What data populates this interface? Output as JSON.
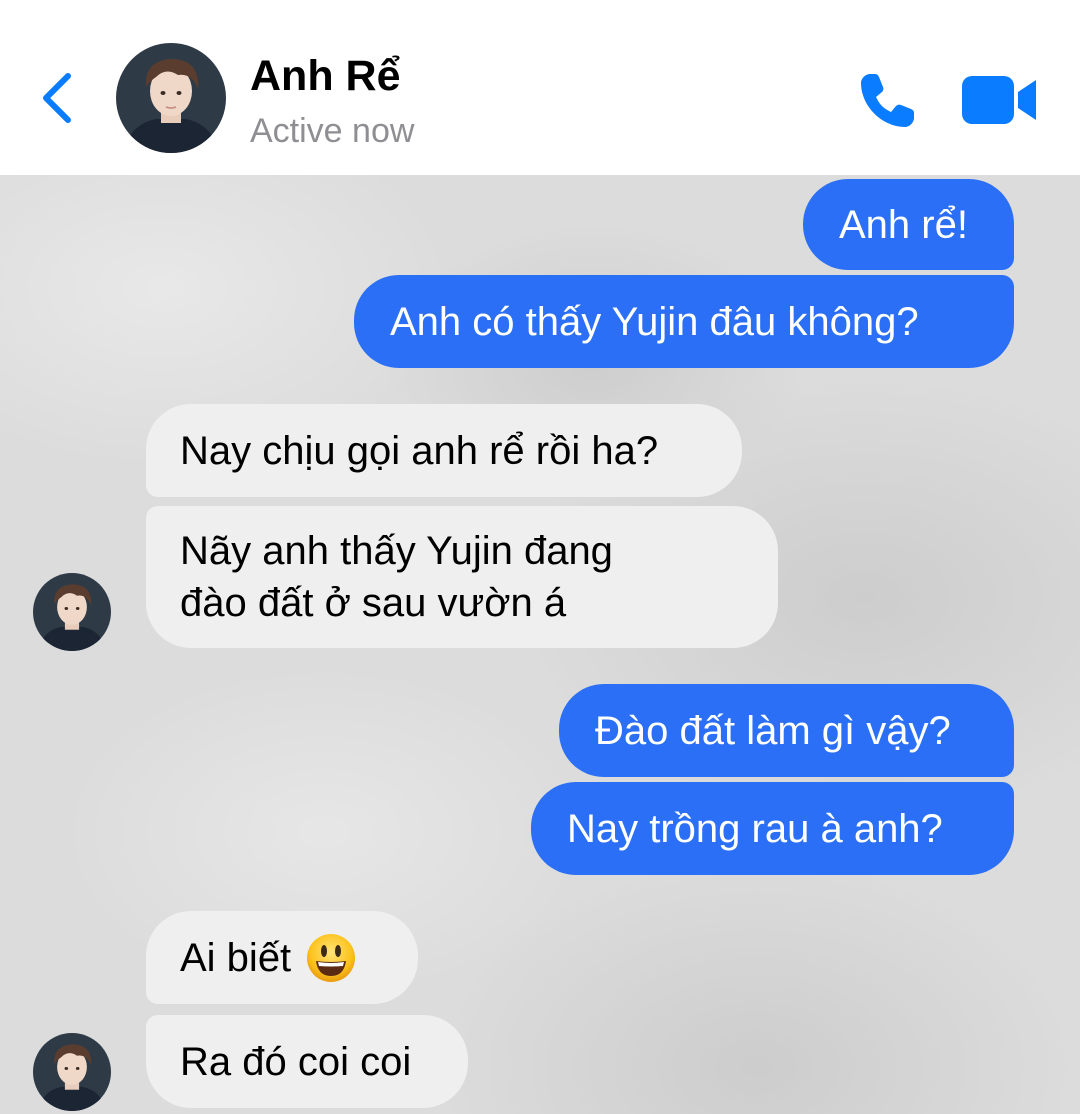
{
  "header": {
    "contact_name": "Anh Rể",
    "status": "Active now"
  },
  "messages": [
    {
      "sender": "me",
      "text": "Anh rể!"
    },
    {
      "sender": "me",
      "text": "Anh có thấy Yujin đâu không?"
    },
    {
      "sender": "contact",
      "text": "Nay chịu gọi anh rể rồi ha?"
    },
    {
      "sender": "contact",
      "lines": [
        "Nãy anh thấy Yujin đang",
        "đào đất ở sau vườn á"
      ]
    },
    {
      "sender": "me",
      "text": "Đào đất làm gì vậy?"
    },
    {
      "sender": "me",
      "text": "Nay trồng rau à anh?"
    },
    {
      "sender": "contact",
      "text": "Ai biết",
      "emoji": "smiling-face-emoji"
    },
    {
      "sender": "contact",
      "text": "Ra đó coi coi"
    }
  ],
  "colors": {
    "accent": "#0a7cff",
    "outgoing_bubble": "#2a6ff5",
    "incoming_bubble": "#efefef",
    "chat_background": "#dcdcdc",
    "status_text": "#8e8e93"
  },
  "icons": {
    "back": "chevron-left-icon",
    "call": "phone-icon",
    "video": "video-camera-icon"
  }
}
